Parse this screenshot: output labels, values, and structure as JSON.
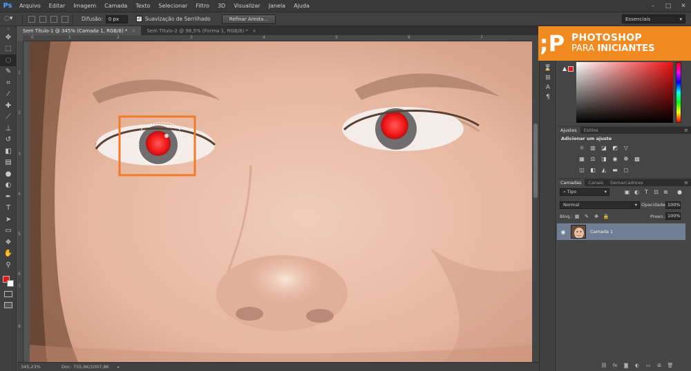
{
  "app": {
    "logo": "Ps"
  },
  "menu": [
    "Arquivo",
    "Editar",
    "Imagem",
    "Camada",
    "Texto",
    "Selecionar",
    "Filtro",
    "3D",
    "Visualizar",
    "Janela",
    "Ajuda"
  ],
  "options": {
    "feather_label": "Difusão:",
    "feather_value": "0 px",
    "antialias_label": "Suavização de Serrilhado",
    "refine_button": "Refinar Aresta...",
    "workspace": "Essenciais"
  },
  "tabs": [
    {
      "label": "Sem Título-1 @ 345% (Camada 1, RGB/8) *",
      "close": "×"
    },
    {
      "label": "Sem Título-2 @ 98,5% (Forma 1, RGB/8) *",
      "close": "×"
    }
  ],
  "rulers": {
    "top": [
      "0",
      "1",
      "2",
      "3",
      "4",
      "5",
      "6",
      "7"
    ],
    "left": [
      "1",
      "2",
      "3",
      "4",
      "5",
      "6",
      "7",
      "8"
    ]
  },
  "status": {
    "zoom": "345,23%",
    "doc": "Doc: 755,9K/1007,8K"
  },
  "brand": {
    "mark": ";P",
    "title": "PHOTOSHOP",
    "sub_a": "PARA",
    "sub_b": "INICIANTES"
  },
  "adjust_panel": {
    "tabs": [
      "Ajustes",
      "Estilos"
    ],
    "title": "Adicionar um ajuste"
  },
  "layers_panel": {
    "tabs": [
      "Camadas",
      "Canais",
      "Demarcadores"
    ],
    "filter": "Tipo",
    "blend_mode": "Normal",
    "opacity_label": "Opacidade:",
    "opacity_value": "100%",
    "lock_label": "Bloq.:",
    "fill_label": "Preen.:",
    "fill_value": "100%",
    "layer_name": "Camada 1"
  },
  "colors": {
    "foreground": "#ee1111",
    "background": "#ffffff",
    "highlight": "#f07a2a",
    "selected_layer": "#6f7e95"
  }
}
